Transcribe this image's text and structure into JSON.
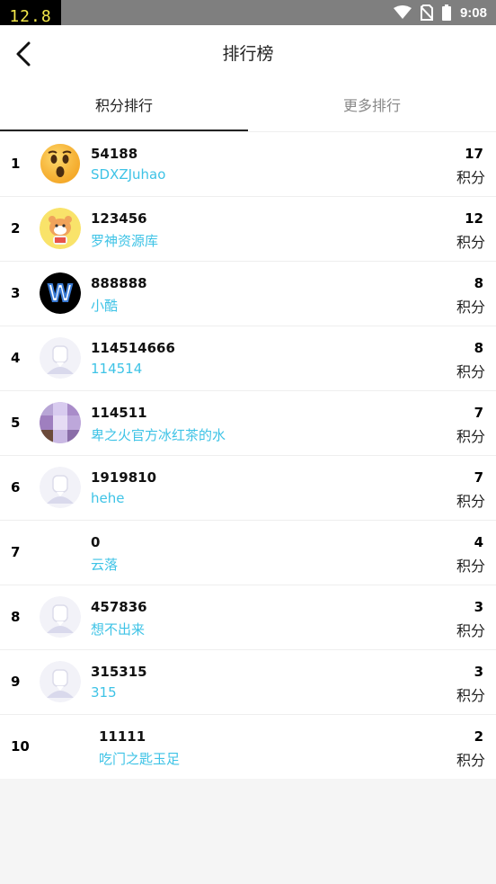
{
  "status_bar": {
    "speed": "12.8",
    "time": "9:08",
    "icons": [
      "wifi-icon",
      "no-sim-icon",
      "battery-icon"
    ]
  },
  "header": {
    "title": "排行榜",
    "back_icon": "chevron-left-icon"
  },
  "tabs": [
    {
      "label": "积分排行",
      "active": true
    },
    {
      "label": "更多排行",
      "active": false
    }
  ],
  "points_label": "积分",
  "colors": {
    "name": "#3ec3e6",
    "tab_active": "#222222",
    "tab_inactive": "#888888"
  },
  "ranking": [
    {
      "rank": "1",
      "id": "54188",
      "name": "SDXZJuhao",
      "points": "17",
      "avatar": "emoji-surprised"
    },
    {
      "rank": "2",
      "id": "123456",
      "name": "罗神资源库",
      "points": "12",
      "avatar": "cartoon-tiger"
    },
    {
      "rank": "3",
      "id": "888888",
      "name": "小酷",
      "points": "8",
      "avatar": "letter-w"
    },
    {
      "rank": "4",
      "id": "114514666",
      "name": "114514",
      "points": "8",
      "avatar": "default"
    },
    {
      "rank": "5",
      "id": "114511",
      "name": "卑之火官方冰红茶的水",
      "points": "7",
      "avatar": "pixelated"
    },
    {
      "rank": "6",
      "id": "1919810",
      "name": "hehe",
      "points": "7",
      "avatar": "default"
    },
    {
      "rank": "7",
      "id": "0",
      "name": "云落",
      "points": "4",
      "avatar": "none"
    },
    {
      "rank": "8",
      "id": "457836",
      "name": "想不出来",
      "points": "3",
      "avatar": "default"
    },
    {
      "rank": "9",
      "id": "315315",
      "name": "315",
      "points": "3",
      "avatar": "default"
    },
    {
      "rank": "10",
      "id": "11111",
      "name": "吃门之匙玉足",
      "points": "2",
      "avatar": "none"
    }
  ]
}
